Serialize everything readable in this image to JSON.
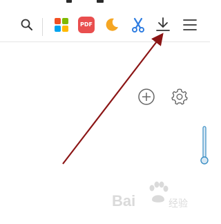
{
  "toolbar": {
    "icons": {
      "search": "search-icon",
      "apps": "apps-grid-icon",
      "pdf": "pdf-icon",
      "night": "night-mode-icon",
      "screenshot": "scissors-icon",
      "download": "download-icon",
      "menu": "menu-icon"
    },
    "pdf_label": "PDF"
  },
  "content": {
    "icons": {
      "add": "plus-circle-icon",
      "settings": "gear-icon"
    }
  },
  "watermark": {
    "text": "Bai",
    "text2": "经验"
  },
  "colors": {
    "arrow": "#8b1515",
    "scroll": "#3b8fc4",
    "pdf": "#e94e4e",
    "night": "#f5a623",
    "scissors": "#2f7de1"
  }
}
